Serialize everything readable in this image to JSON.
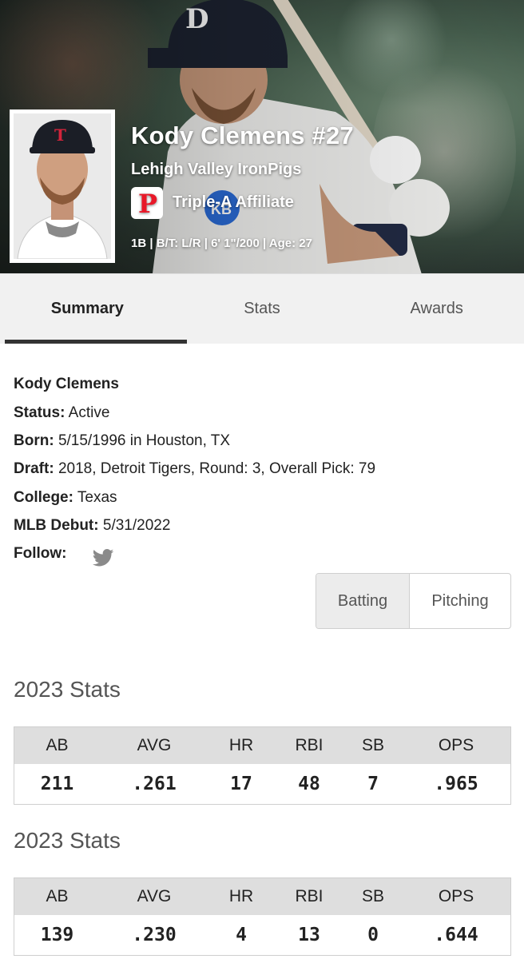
{
  "player": {
    "name": "Kody Clemens #27",
    "team": "Lehigh Valley IronPigs",
    "affiliate": "Triple-A Affiliate",
    "bio_line": "1B | B/T: L/R | 6' 1\"/200 | Age: 27"
  },
  "tabs": [
    {
      "label": "Summary",
      "active": true
    },
    {
      "label": "Stats",
      "active": false
    },
    {
      "label": "Awards",
      "active": false
    }
  ],
  "info": {
    "full_name": "Kody Clemens",
    "status_label": "Status:",
    "status_value": "Active",
    "born_label": "Born:",
    "born_value": "5/15/1996 in Houston, TX",
    "draft_label": "Draft:",
    "draft_value": "2018, Detroit Tigers, Round: 3, Overall Pick: 79",
    "college_label": "College:",
    "college_value": "Texas",
    "debut_label": "MLB Debut:",
    "debut_value": "5/31/2022",
    "follow_label": "Follow:"
  },
  "toggle": {
    "batting": "Batting",
    "pitching": "Pitching",
    "selected": "Batting"
  },
  "stats_sections": [
    {
      "title": "2023 Stats",
      "headers": [
        "AB",
        "AVG",
        "HR",
        "RBI",
        "SB",
        "OPS"
      ],
      "values": [
        "211",
        ".261",
        "17",
        "48",
        "7",
        ".965"
      ]
    },
    {
      "title": "2023 Stats",
      "headers": [
        "AB",
        "AVG",
        "HR",
        "RBI",
        "SB",
        "OPS"
      ],
      "values": [
        "139",
        ".230",
        "4",
        "13",
        "0",
        ".644"
      ]
    }
  ],
  "colors": {
    "phillies_red": "#e81828",
    "header_gray": "#dedede",
    "tab_bg": "#f1f1f1"
  },
  "icons": {
    "follow": "twitter-icon",
    "affiliate": "phillies-logo-icon"
  }
}
